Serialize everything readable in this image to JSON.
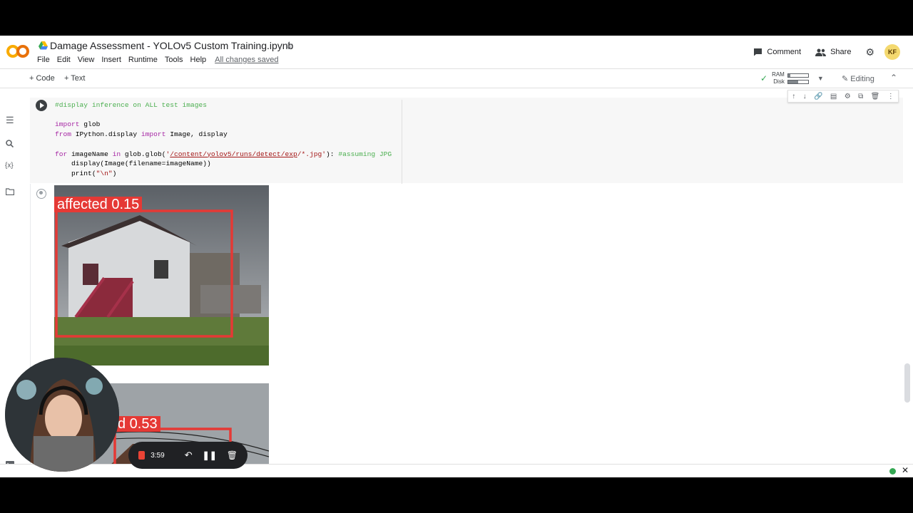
{
  "header": {
    "title": "Damage Assessment - YOLOv5 Custom Training.ipynb",
    "menu": [
      "File",
      "Edit",
      "View",
      "Insert",
      "Runtime",
      "Tools",
      "Help"
    ],
    "save_status": "All changes saved",
    "comment_label": "Comment",
    "share_label": "Share",
    "avatar_initials": "KF"
  },
  "toolbar": {
    "add_code": "+ Code",
    "add_text": "+ Text",
    "ram_label": "RAM",
    "disk_label": "Disk",
    "ram_usage": 0.1,
    "disk_usage": 0.5,
    "editing_label": "Editing"
  },
  "cell": {
    "code_lines": [
      "#display inference on ALL test images",
      "",
      "import glob",
      "from IPython.display import Image, display",
      "",
      "for imageName in glob.glob('/content/yolov5/runs/detect/exp/*.jpg'): #assuming JPG",
      "    display(Image(filename=imageName))",
      "    print(\"\\n\")"
    ]
  },
  "outputs": [
    {
      "label": "affected 0.15"
    },
    {
      "label": "d 0.53"
    }
  ],
  "recorder": {
    "elapsed": "3:59"
  },
  "colors": {
    "detection_box": "#e53935",
    "status_ok": "#34a853",
    "comment_green": "#4caf50",
    "keyword_purple": "#a626a4"
  }
}
